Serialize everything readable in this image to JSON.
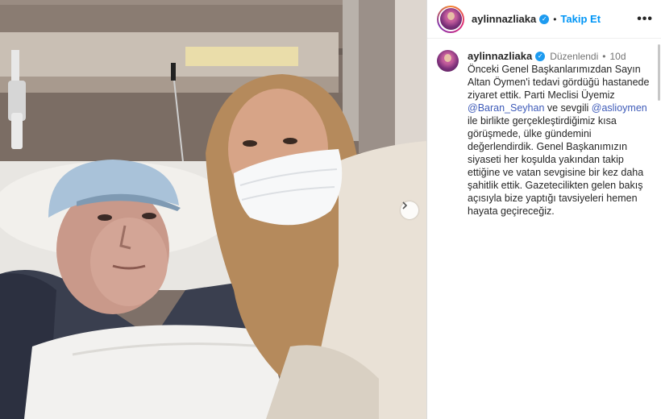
{
  "header": {
    "username": "aylinnazliaka",
    "follow_label": "Takip Et",
    "separator": "•"
  },
  "caption": {
    "username": "aylinnazliaka",
    "edited_label": "Düzenlendi",
    "separator": "•",
    "time": "10d",
    "text_1": "Önceki Genel Başkanlarımızdan Sayın Altan Öymen'i tedavi gördüğü hastanede ziyaret ettik. Parti Meclisi Üyemiz ",
    "mention_1": "@Baran_Seyhan",
    "text_2": " ve sevgili ",
    "mention_2": "@aslioymen",
    "text_3": " ile birlikte gerçekleştirdiğimiz kısa görüşmede, ülke gündemini değerlendirdik. Genel Başkanımızın siyaseti her koşulda yakından takip ettiğine ve vatan sevgisine bir kez daha şahitlik ettik. Gazetecilikten gelen bakış açısıyla bize yaptığı tavsiyeleri hemen hayata geçireceğiz."
  },
  "colors": {
    "accent": "#0095f6",
    "mention": "#3d5ab8",
    "verified": "#1d9bf0",
    "muted": "#737373"
  },
  "icons": [
    "verified-badge-icon",
    "more-options-icon",
    "next-arrow-icon"
  ]
}
